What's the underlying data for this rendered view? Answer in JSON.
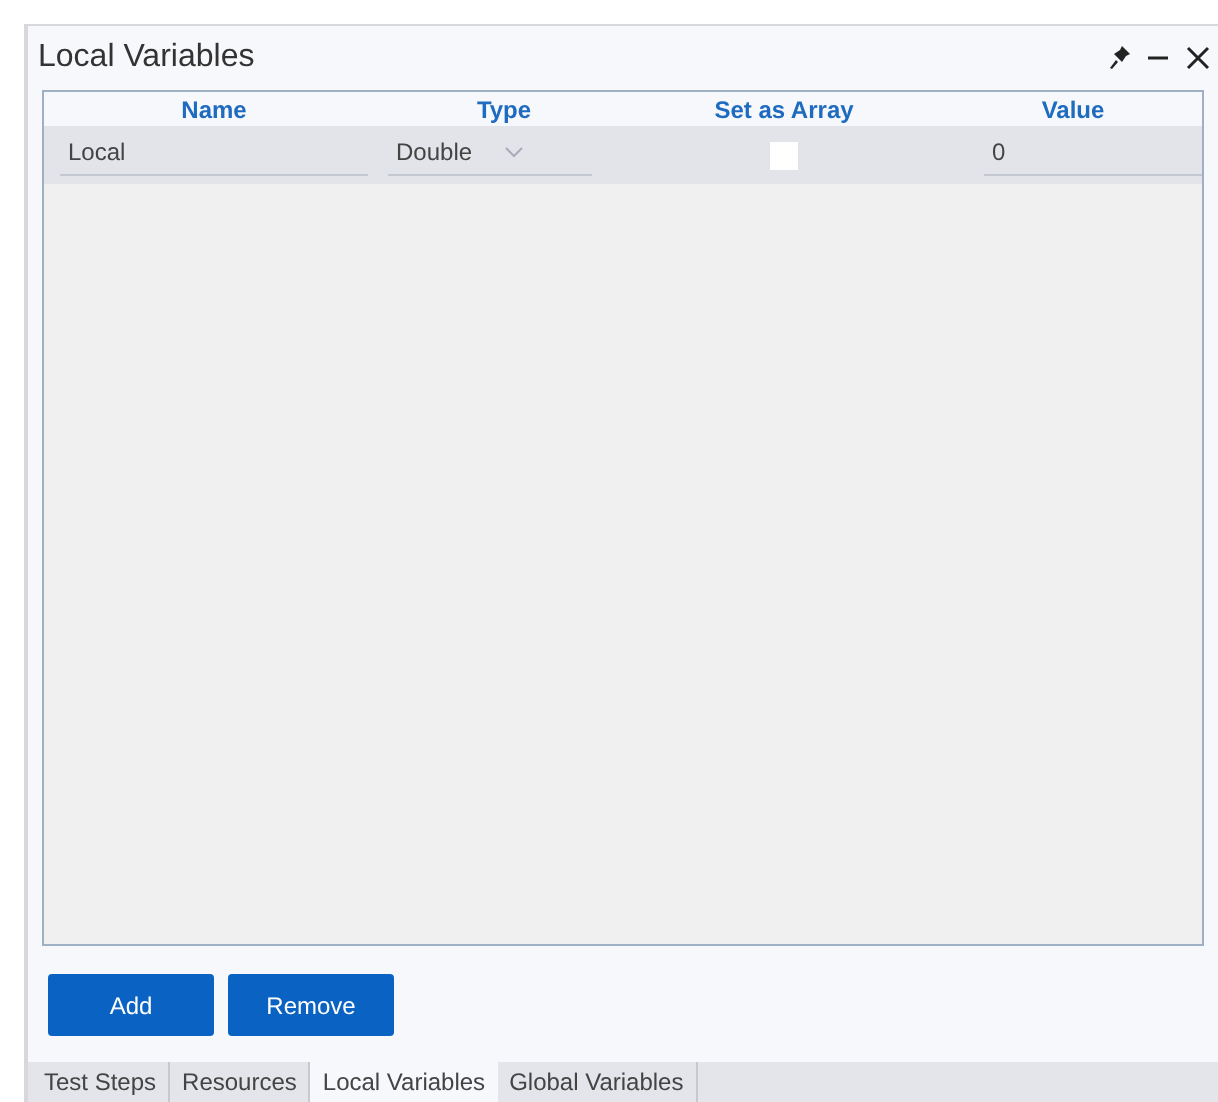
{
  "window": {
    "title": "Local Variables"
  },
  "table": {
    "columns": [
      "Name",
      "Type",
      "Set as Array",
      "Value"
    ],
    "rows": [
      {
        "name": "Local",
        "type": "Double",
        "set_as_array": false,
        "value": "0"
      }
    ]
  },
  "buttons": [
    "Add",
    "Remove"
  ],
  "tabs": [
    {
      "label": "Test Steps",
      "selected": false
    },
    {
      "label": "Resources",
      "selected": false
    },
    {
      "label": "Local Variables",
      "selected": true
    },
    {
      "label": "Global Variables",
      "selected": false
    }
  ]
}
